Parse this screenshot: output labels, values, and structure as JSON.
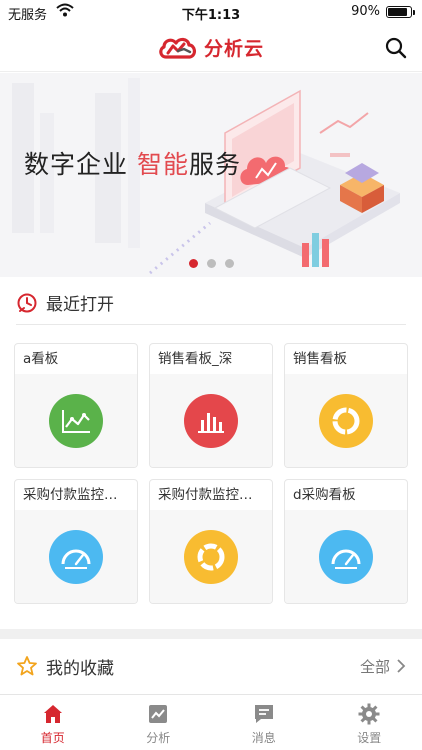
{
  "status_bar": {
    "carrier": "无服务",
    "time": "下午1:13",
    "battery": "90%"
  },
  "nav": {
    "app_name": "分析云",
    "brand_color": "#d6272f"
  },
  "banner": {
    "title_prefix": "数字企业 ",
    "title_highlight": "智能",
    "title_suffix": "服务",
    "page_count": 3,
    "active_page": 1
  },
  "recent": {
    "title": "最近打开",
    "cards": [
      {
        "title": "a看板",
        "icon": "line-chart-icon",
        "color": "#5ab24a"
      },
      {
        "title": "销售看板_深",
        "icon": "bar-chart-icon",
        "color": "#e4474b"
      },
      {
        "title": "销售看板",
        "icon": "donut-chart-icon",
        "color": "#f8bc31"
      },
      {
        "title": "采购付款监控看板",
        "icon": "gauge-icon",
        "color": "#4cb9f1"
      },
      {
        "title": "采购付款监控看...",
        "icon": "donut-chart-icon",
        "color": "#f8bc31"
      },
      {
        "title": "d采购看板",
        "icon": "gauge-icon",
        "color": "#4cb9f1"
      }
    ]
  },
  "favorites": {
    "title": "我的收藏",
    "more_label": "全部"
  },
  "tabs": [
    {
      "label": "首页",
      "icon": "home-icon",
      "active": true
    },
    {
      "label": "分析",
      "icon": "analysis-icon",
      "active": false
    },
    {
      "label": "消息",
      "icon": "message-icon",
      "active": false
    },
    {
      "label": "设置",
      "icon": "settings-gear-icon",
      "active": false
    }
  ]
}
